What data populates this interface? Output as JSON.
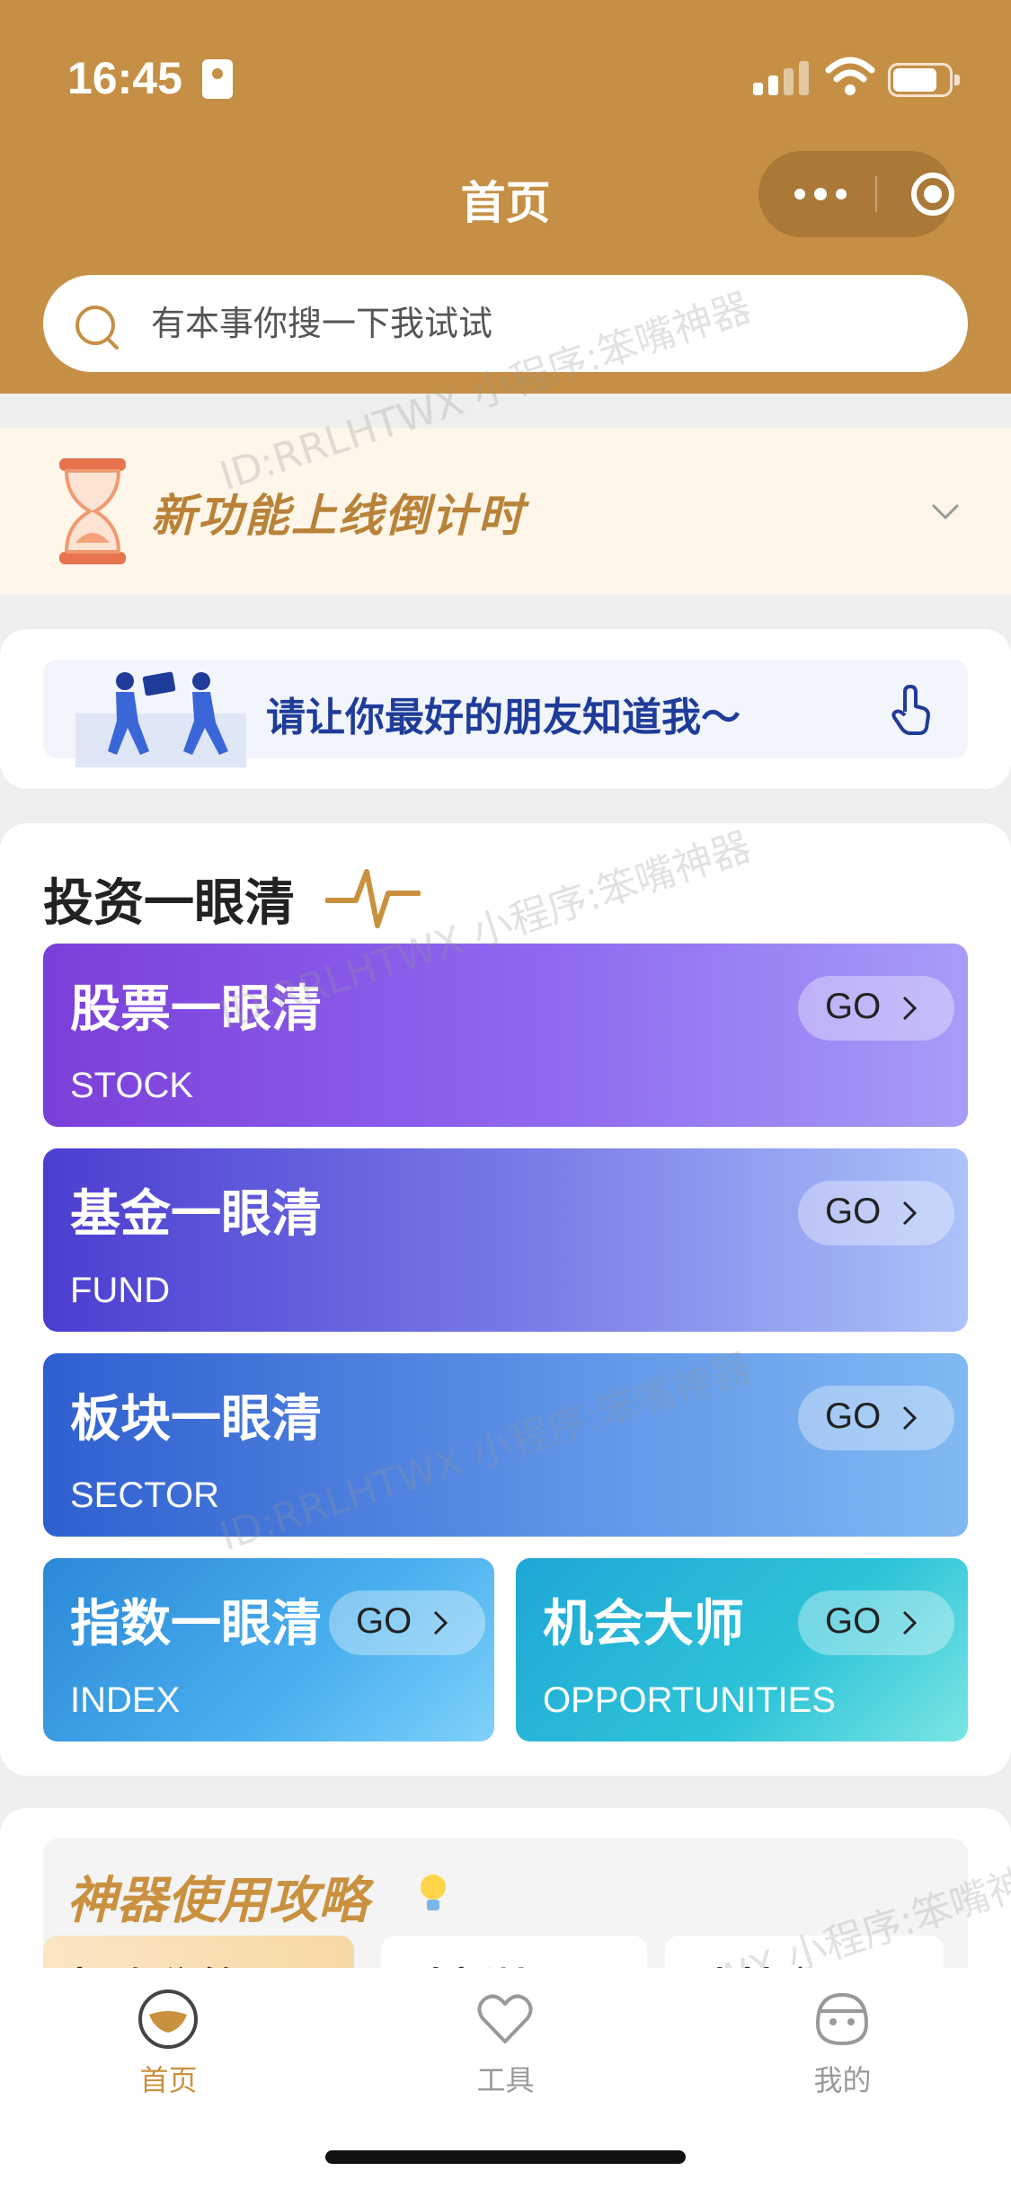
{
  "status_bar": {
    "time": "16:45"
  },
  "nav": {
    "title": "首页"
  },
  "search": {
    "placeholder": "有本事你搜一下我试试"
  },
  "countdown": {
    "title": "新功能上线倒计时"
  },
  "invite": {
    "text": "请让你最好的朋友知道我～"
  },
  "invest": {
    "title": "投资一眼清",
    "go_label": "GO",
    "tiles": [
      {
        "title": "股票一眼清",
        "subtitle": "STOCK"
      },
      {
        "title": "基金一眼清",
        "subtitle": "FUND"
      },
      {
        "title": "板块一眼清",
        "subtitle": "SECTOR"
      },
      {
        "title": "指数一眼清",
        "subtitle": "INDEX"
      },
      {
        "title": "机会大师",
        "subtitle": "OPPORTUNITIES"
      }
    ]
  },
  "guide": {
    "title": "神器使用攻略",
    "tabs": [
      "投资秘籍",
      "选板块",
      "选基金"
    ]
  },
  "tabbar": {
    "items": [
      {
        "label": "首页",
        "icon": "home-icon",
        "active": true
      },
      {
        "label": "工具",
        "icon": "heart-icon",
        "active": false
      },
      {
        "label": "我的",
        "icon": "profile-icon",
        "active": false
      }
    ]
  },
  "watermark": {
    "text": "ID:RRLHTWX 小程序:笨嘴神器"
  },
  "colors": {
    "brand": "#c59045",
    "accent_text": "#c9913f",
    "invite_text": "#1f3c9a"
  }
}
